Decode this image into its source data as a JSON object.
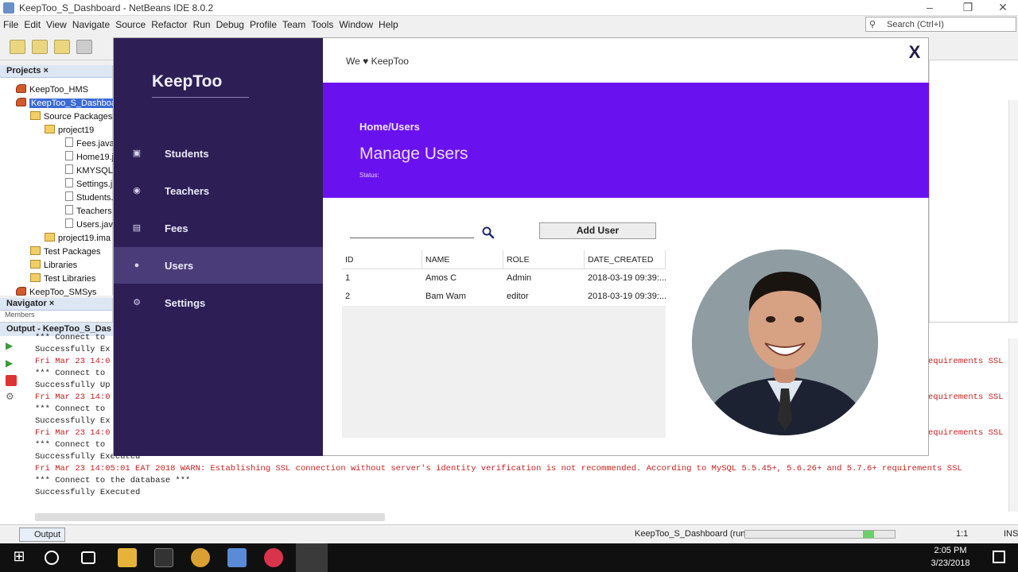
{
  "ide": {
    "title": "KeepToo_S_Dashboard - NetBeans IDE 8.0.2",
    "menu": [
      "File",
      "Edit",
      "View",
      "Navigate",
      "Source",
      "Refactor",
      "Run",
      "Debug",
      "Profile",
      "Team",
      "Tools",
      "Window",
      "Help"
    ],
    "search_placeholder": "Search (Ctrl+I)",
    "projects_tab": "Projects",
    "tree": [
      {
        "label": "KeepToo_HMS",
        "kind": "proj",
        "depth": 1
      },
      {
        "label": "KeepToo_S_Dashboa",
        "kind": "proj",
        "depth": 1,
        "selected": true
      },
      {
        "label": "Source Packages",
        "kind": "folder",
        "depth": 2
      },
      {
        "label": "project19",
        "kind": "folder",
        "depth": 3
      },
      {
        "label": "Fees.java",
        "kind": "file",
        "depth": 4
      },
      {
        "label": "Home19.j",
        "kind": "file",
        "depth": 4
      },
      {
        "label": "KMYSQL.j",
        "kind": "file",
        "depth": 4
      },
      {
        "label": "Settings.j",
        "kind": "file",
        "depth": 4
      },
      {
        "label": "Students.",
        "kind": "file",
        "depth": 4
      },
      {
        "label": "Teachers",
        "kind": "file",
        "depth": 4
      },
      {
        "label": "Users.jav",
        "kind": "file",
        "depth": 4
      },
      {
        "label": "project19.ima",
        "kind": "folder",
        "depth": 3
      },
      {
        "label": "Test Packages",
        "kind": "folder",
        "depth": 2
      },
      {
        "label": "Libraries",
        "kind": "folder",
        "depth": 2
      },
      {
        "label": "Test Libraries",
        "kind": "folder",
        "depth": 2
      },
      {
        "label": "KeepToo_SMSys",
        "kind": "proj",
        "depth": 1
      }
    ],
    "navigator_tab": "Navigator",
    "navigator_sub": "Members",
    "output_tab": "Output - KeepToo_S_Das",
    "output_lines": [
      {
        "text": "*** Connect to",
        "red": false
      },
      {
        "text": "Successfully Ex",
        "red": false
      },
      {
        "text": "Fri Mar 23 14:0",
        "red": true
      },
      {
        "text": "*** Connect to",
        "red": false
      },
      {
        "text": "Successfully Up",
        "red": false
      },
      {
        "text": "Fri Mar 23 14:0",
        "red": true
      },
      {
        "text": "*** Connect to",
        "red": false
      },
      {
        "text": "Successfully Ex",
        "red": false
      },
      {
        "text": "Fri Mar 23 14:0",
        "red": true
      },
      {
        "text": "*** Connect to",
        "red": false
      },
      {
        "text": "Successfully Executed",
        "red": false
      },
      {
        "text": "Fri Mar 23 14:05:01 EAT 2018 WARN: Establishing SSL connection without server's identity verification is not recommended. According to MySQL 5.5.45+, 5.6.26+ and 5.7.6+ requirements SSL",
        "red": true
      },
      {
        "text": "*** Connect to the database ***",
        "red": false
      },
      {
        "text": "Successfully Executed",
        "red": false
      }
    ],
    "right_fragments": [
      "equirements SSL",
      "equirements SSL",
      "equirements SSL"
    ],
    "status_bottom_tab": "Output",
    "status_run": "KeepToo_S_Dashboard (run)",
    "status_pos": "1:1",
    "status_mode": "INS",
    "clock_time": "2:05 PM",
    "clock_date": "3/23/2018"
  },
  "app": {
    "brand": "KeepToo",
    "topbar": "We ♥ KeepToo",
    "close": "X",
    "nav": [
      {
        "label": "Students",
        "icon": "laptop-icon",
        "active": false
      },
      {
        "label": "Teachers",
        "icon": "globe-icon",
        "active": false
      },
      {
        "label": "Fees",
        "icon": "money-icon",
        "active": false
      },
      {
        "label": "Users",
        "icon": "user-icon",
        "active": true
      },
      {
        "label": "Settings",
        "icon": "gear-icon",
        "active": false
      }
    ],
    "breadcrumb": "Home/Users",
    "page_title": "Manage Users",
    "status": "Status:",
    "add_user": "Add User",
    "search_value": "",
    "table": {
      "headers": [
        "ID",
        "NAME",
        "ROLE",
        "DATE_CREATED"
      ],
      "rows": [
        [
          "1",
          "Amos C",
          "Admin",
          "2018-03-19 09:39:..."
        ],
        [
          "2",
          "Bam Wam",
          "editor",
          "2018-03-19 09:39:..."
        ]
      ]
    },
    "colors": {
      "sidebar": "#2d1f55",
      "banner": "#6a11f0",
      "active": "#4a3c78"
    }
  }
}
